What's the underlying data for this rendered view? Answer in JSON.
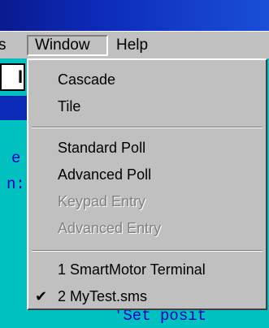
{
  "menubar": {
    "partial_label": "s",
    "window_label": "Window",
    "help_label": "Help"
  },
  "background": {
    "toolbar_char": "I",
    "code_char_1": "e",
    "code_char_2": "n:",
    "bottom_text": "'Set posit"
  },
  "window_menu": {
    "items": [
      {
        "label": "Cascade",
        "enabled": true
      },
      {
        "label": "Tile",
        "enabled": true
      },
      {
        "label": "Standard Poll",
        "enabled": true
      },
      {
        "label": "Advanced Poll",
        "enabled": true
      },
      {
        "label": "Keypad Entry",
        "enabled": false
      },
      {
        "label": "Advanced Entry",
        "enabled": false
      },
      {
        "label": "1  SmartMotor Terminal",
        "enabled": true,
        "checked": false
      },
      {
        "label": "2 MyTest.sms",
        "enabled": true,
        "checked": true
      }
    ],
    "check_glyph": "✔"
  }
}
